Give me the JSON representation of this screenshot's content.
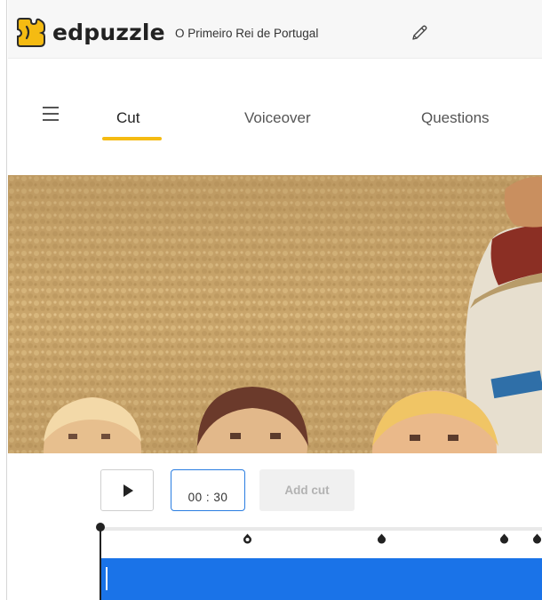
{
  "header": {
    "brand": "edpuzzle",
    "video_title": "O Primeiro Rei de Portugal",
    "logo_icon": "edpuzzle-puzzle-logo",
    "edit_icon": "pencil-icon",
    "brand_color": "#f5bb12"
  },
  "tabs": [
    {
      "label": "Cut",
      "active": true
    },
    {
      "label": "Voiceover",
      "active": false
    },
    {
      "label": "Questions",
      "active": false
    }
  ],
  "controls": {
    "play_icon": "play-icon",
    "time": "00 : 30",
    "add_cut_label": "Add cut"
  },
  "timeline": {
    "bar_color": "#1a73e8",
    "markers": [
      {
        "type": "hollow"
      },
      {
        "type": "filled"
      },
      {
        "type": "filled"
      },
      {
        "type": "filled"
      }
    ]
  }
}
